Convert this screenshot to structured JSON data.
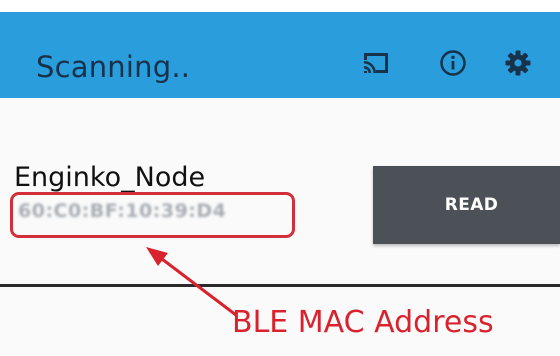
{
  "app_bar": {
    "title": "Scanning..",
    "background": "#2a9ddc",
    "icons": [
      "cast-icon",
      "info-icon",
      "gear-icon"
    ]
  },
  "device": {
    "name": "Enginko_Node",
    "mac_address": "60:C0:BF:10:39:D4",
    "read_label": "READ"
  },
  "annotation": {
    "label": "BLE MAC Address",
    "color": "#d8232f"
  }
}
